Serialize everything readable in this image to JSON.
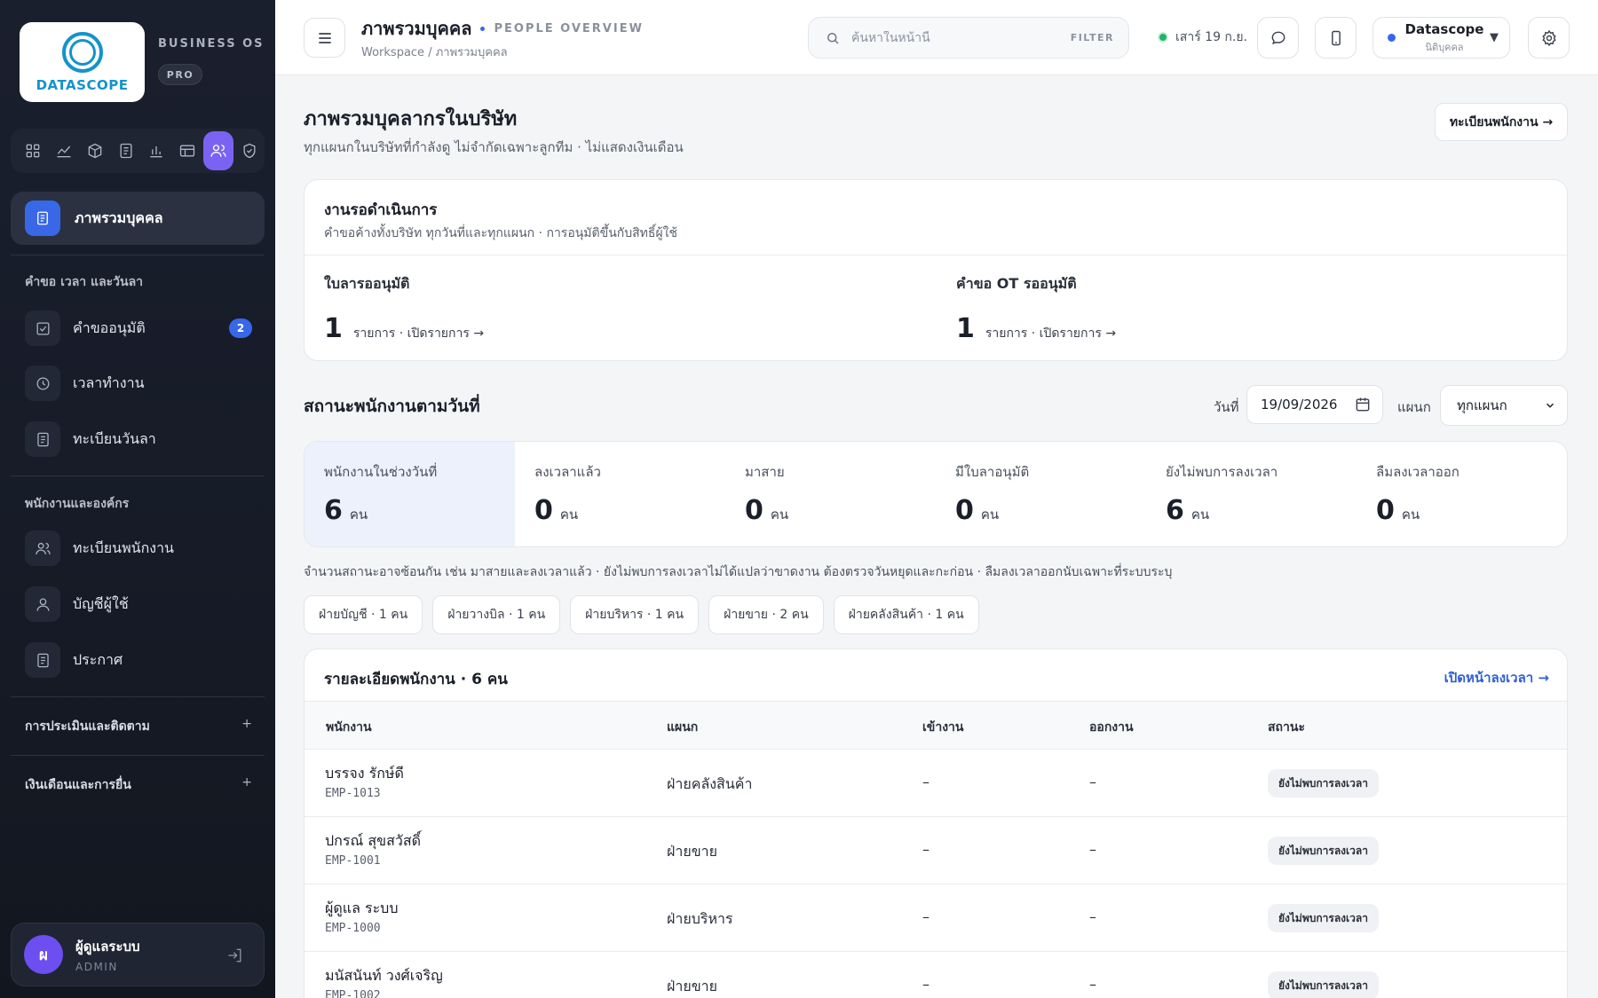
{
  "sidebar": {
    "logo_text": "DATASCOPE",
    "brand": "BUSINESS OS",
    "plan": "PRO",
    "icon_bar": [
      "dashboard-icon",
      "chart-icon",
      "box-icon",
      "document-icon",
      "bar-chart-icon",
      "table-icon",
      "people-icon",
      "shield-icon"
    ],
    "active_item": "ภาพรวมบุคคล",
    "section1": "คำขอ เวลา และวันลา",
    "approvals": "คำขออนุมัติ",
    "approvals_badge": "2",
    "worktime": "เวลาทำงาน",
    "leave_register": "ทะเบียนวันลา",
    "section2": "พนักงานและองค์กร",
    "employee_register": "ทะเบียนพนักงาน",
    "user_accounts": "บัญชีผู้ใช้",
    "announcements": "ประกาศ",
    "section3": "การประเมินและติดตาม",
    "section4": "เงินเดือนและการยื่น",
    "plus": "+",
    "user_initial": "ผ",
    "user_name": "ผู้ดูแลระบบ",
    "user_role": "ADMIN"
  },
  "topbar": {
    "title": "ภาพรวมบุคคล",
    "title_en": "PEOPLE OVERVIEW",
    "breadcrumb": "Workspace / ภาพรวมบุคคล",
    "search_placeholder": "ค้นหาในหน้านี้",
    "filter": "FILTER",
    "date": "เสาร์ 19 ก.ย.",
    "org_name": "Datascope",
    "org_type": "นิติบุคคล",
    "org_caret": "▼"
  },
  "main": {
    "title": "ภาพรวมบุคลากรในบริษัท",
    "subtitle": "ทุกแผนกในบริษัทที่กำลังดู ไม่จำกัดเฉพาะลูกทีม · ไม่แสดงเงินเดือน",
    "register_button": "ทะเบียนพนักงาน →",
    "pending": {
      "title": "งานรอดำเนินการ",
      "subtitle": "คำขอค้างทั้งบริษัท ทุกวันที่และทุกแผนก · การอนุมัติขึ้นกับสิทธิ์ผู้ใช้",
      "leave_label": "ใบลารออนุมัติ",
      "leave_count": "1",
      "leave_link": "รายการ · เปิดรายการ →",
      "ot_label": "คำขอ OT รออนุมัติ",
      "ot_count": "1",
      "ot_link": "รายการ · เปิดรายการ →"
    },
    "status": {
      "title": "สถานะพนักงานตามวันที่",
      "date_label": "วันที่",
      "date_value": "19/09/2026",
      "dept_label": "แผนก",
      "dept_value": "ทุกแผนก",
      "unit": "คน",
      "stats": [
        {
          "label": "พนักงานในช่วงวันที่",
          "value": "6"
        },
        {
          "label": "ลงเวลาแล้ว",
          "value": "0"
        },
        {
          "label": "มาสาย",
          "value": "0"
        },
        {
          "label": "มีใบลาอนุมัติ",
          "value": "0"
        },
        {
          "label": "ยังไม่พบการลงเวลา",
          "value": "6"
        },
        {
          "label": "ลืมลงเวลาออก",
          "value": "0"
        }
      ],
      "note": "จำนวนสถานะอาจซ้อนกัน เช่น มาสายและลงเวลาแล้ว · ยังไม่พบการลงเวลาไม่ได้แปลว่าขาดงาน ต้องตรวจวันหยุดและกะก่อน · ลืมลงเวลาออกนับเฉพาะที่ระบบระบุ",
      "chips": [
        "ฝ่ายบัญชี · 1 คน",
        "ฝ่ายวางบิล · 1 คน",
        "ฝ่ายบริหาร · 1 คน",
        "ฝ่ายขาย · 2 คน",
        "ฝ่ายคลังสินค้า · 1 คน"
      ]
    },
    "table": {
      "title": "รายละเอียดพนักงาน · 6 คน",
      "open_link": "เปิดหน้าลงเวลา →",
      "headers": [
        "พนักงาน",
        "แผนก",
        "เข้างาน",
        "ออกงาน",
        "สถานะ"
      ],
      "rows": [
        {
          "name": "บรรจง รักษ์ดี",
          "code": "EMP-1013",
          "dept": "ฝ่ายคลังสินค้า",
          "in": "–",
          "out": "–",
          "status": "ยังไม่พบการลงเวลา"
        },
        {
          "name": "ปกรณ์ สุขสวัสดิ์",
          "code": "EMP-1001",
          "dept": "ฝ่ายขาย",
          "in": "–",
          "out": "–",
          "status": "ยังไม่พบการลงเวลา"
        },
        {
          "name": "ผู้ดูแล ระบบ",
          "code": "EMP-1000",
          "dept": "ฝ่ายบริหาร",
          "in": "–",
          "out": "–",
          "status": "ยังไม่พบการลงเวลา"
        },
        {
          "name": "มนัสนันท์ วงศ์เจริญ",
          "code": "EMP-1002",
          "dept": "ฝ่ายขาย",
          "in": "–",
          "out": "–",
          "status": "ยังไม่พบการลงเวลา"
        }
      ]
    }
  }
}
